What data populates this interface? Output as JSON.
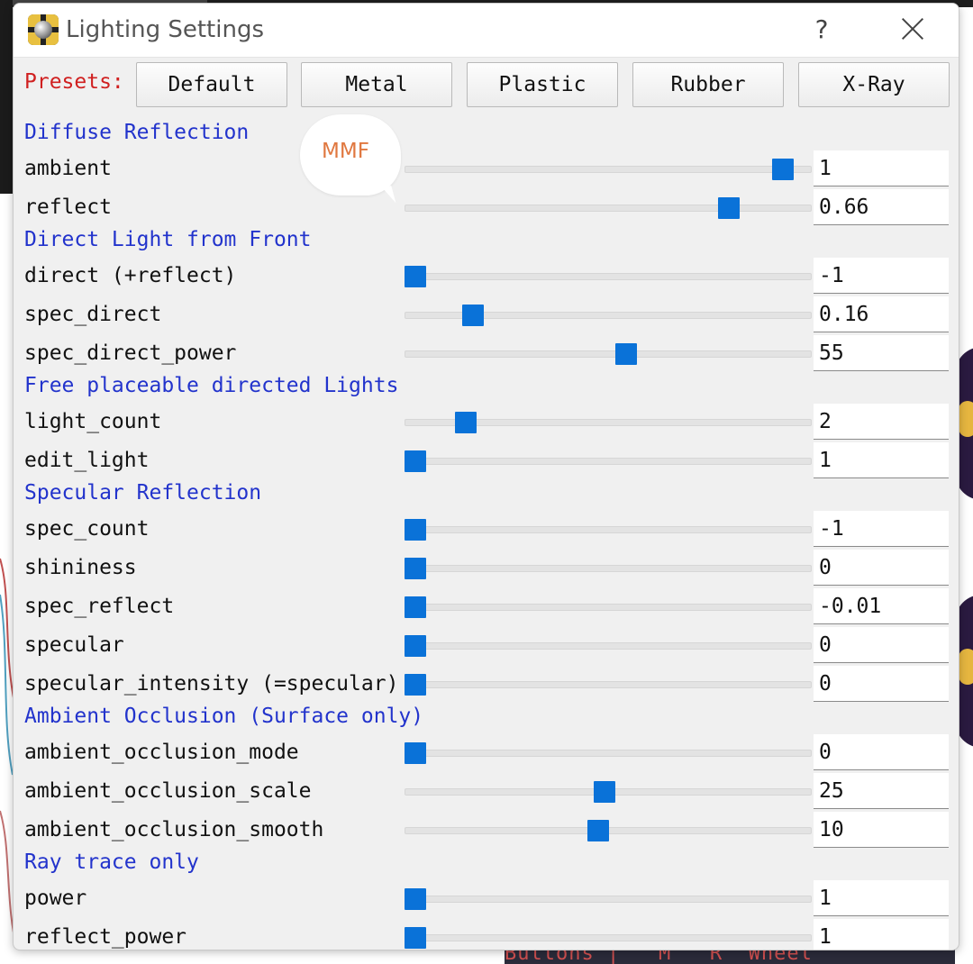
{
  "window": {
    "title": "Lighting Settings",
    "help": "?"
  },
  "presets": {
    "label": "Presets:",
    "buttons": [
      "Default",
      "Metal",
      "Plastic",
      "Rubber",
      "X-Ray"
    ]
  },
  "watermark": "MMF",
  "background": {
    "bottom_text": "Buttons |   M   R  Wheel"
  },
  "sections": [
    {
      "title": "Diffuse Reflection",
      "rows": [
        {
          "label": "ambient",
          "value": "1",
          "level": 0.954
        },
        {
          "label": "reflect",
          "value": "0.66",
          "level": 0.812
        }
      ]
    },
    {
      "title": "Direct Light from Front",
      "rows": [
        {
          "label": "direct (+reflect)",
          "value": "-1",
          "level": 0.0
        },
        {
          "label": "spec_direct",
          "value": "0.16",
          "level": 0.15
        },
        {
          "label": "spec_direct_power",
          "value": "55",
          "level": 0.546
        }
      ]
    },
    {
      "title": "Free placeable directed Lights",
      "rows": [
        {
          "label": "light_count",
          "value": "2",
          "level": 0.13
        },
        {
          "label": "edit_light",
          "value": "1",
          "level": 0.0
        }
      ]
    },
    {
      "title": "Specular Reflection",
      "rows": [
        {
          "label": "spec_count",
          "value": "-1",
          "level": 0.0
        },
        {
          "label": "shininess",
          "value": "0",
          "level": 0.0
        },
        {
          "label": "spec_reflect",
          "value": "-0.01",
          "level": 0.0
        },
        {
          "label": "specular",
          "value": "0",
          "level": 0.0
        },
        {
          "label": "specular_intensity (=specular)",
          "value": "0",
          "level": 0.0
        }
      ]
    },
    {
      "title": "Ambient Occlusion (Surface only)",
      "rows": [
        {
          "label": "ambient_occlusion_mode",
          "value": "0",
          "level": 0.0
        },
        {
          "label": "ambient_occlusion_scale",
          "value": "25",
          "level": 0.491
        },
        {
          "label": "ambient_occlusion_smooth",
          "value": "10",
          "level": 0.475
        }
      ]
    },
    {
      "title": "Ray trace only",
      "rows": [
        {
          "label": "power",
          "value": "1",
          "level": 0.0
        },
        {
          "label": "reflect_power",
          "value": "1",
          "level": 0.0
        }
      ]
    }
  ],
  "colors": {
    "accent": "#0a72d8",
    "section_title": "#2233cc",
    "presets_label": "#d02020",
    "watermark": "#e07840"
  }
}
